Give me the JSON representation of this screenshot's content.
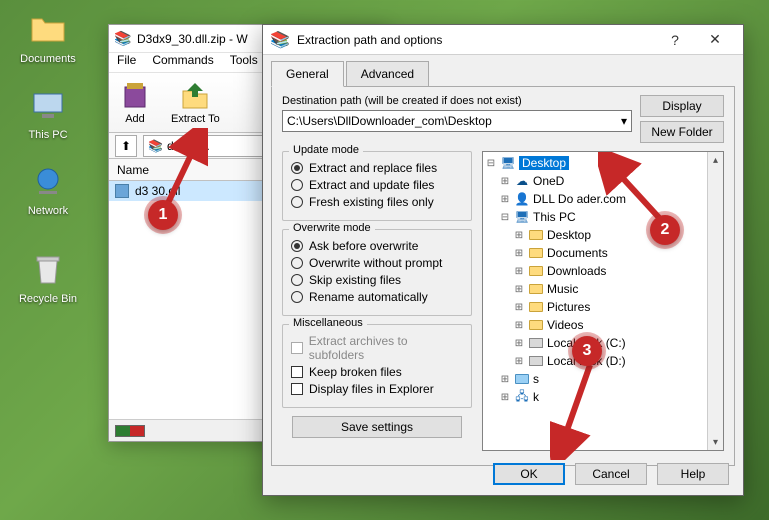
{
  "desktop": {
    "icons": [
      {
        "label": "Documents"
      },
      {
        "label": "This PC"
      },
      {
        "label": "Network"
      },
      {
        "label": "Recycle Bin"
      }
    ]
  },
  "winrar": {
    "title": "D3dx9_30.dll.zip - W",
    "menu": [
      "File",
      "Commands",
      "Tools"
    ],
    "toolbar": {
      "add": "Add",
      "extract": "Extract To"
    },
    "navpath": "dx9_30.",
    "col_name": "Name",
    "file": "d3     30.dll"
  },
  "dialog": {
    "title": "Extraction path and options",
    "tabs": {
      "general": "General",
      "advanced": "Advanced"
    },
    "dest_label": "Destination path (will be created if does not exist)",
    "path": "C:\\Users\\DllDownloader_com\\Desktop",
    "display": "Display",
    "new_folder": "New Folder",
    "update": {
      "title": "Update mode",
      "r1": "Extract and replace files",
      "r2": "Extract and update files",
      "r3": "Fresh existing files only"
    },
    "overwrite": {
      "title": "Overwrite mode",
      "r1": "Ask before overwrite",
      "r2": "Overwrite without prompt",
      "r3": "Skip existing files",
      "r4": "Rename automatically"
    },
    "misc": {
      "title": "Miscellaneous",
      "c1": "Extract archives to subfolders",
      "c2": "Keep broken files",
      "c3": "Display files in Explorer"
    },
    "save": "Save settings",
    "tree": {
      "desktop": "Desktop",
      "onedrive": "OneD",
      "dlldown": "DLL Do       ader.com",
      "thispc": "This PC",
      "t_desktop": "Desktop",
      "t_documents": "Documents",
      "t_downloads": "Downloads",
      "t_music": "Music",
      "t_pictures": "Pictures",
      "t_videos": "Videos",
      "t_c": "Local Disk (C:)",
      "t_d": "Local Disk (D:)",
      "t_lib": "s",
      "t_net": "k"
    },
    "ok": "OK",
    "cancel": "Cancel",
    "help": "Help"
  },
  "callouts": {
    "one": "1",
    "two": "2",
    "three": "3"
  }
}
